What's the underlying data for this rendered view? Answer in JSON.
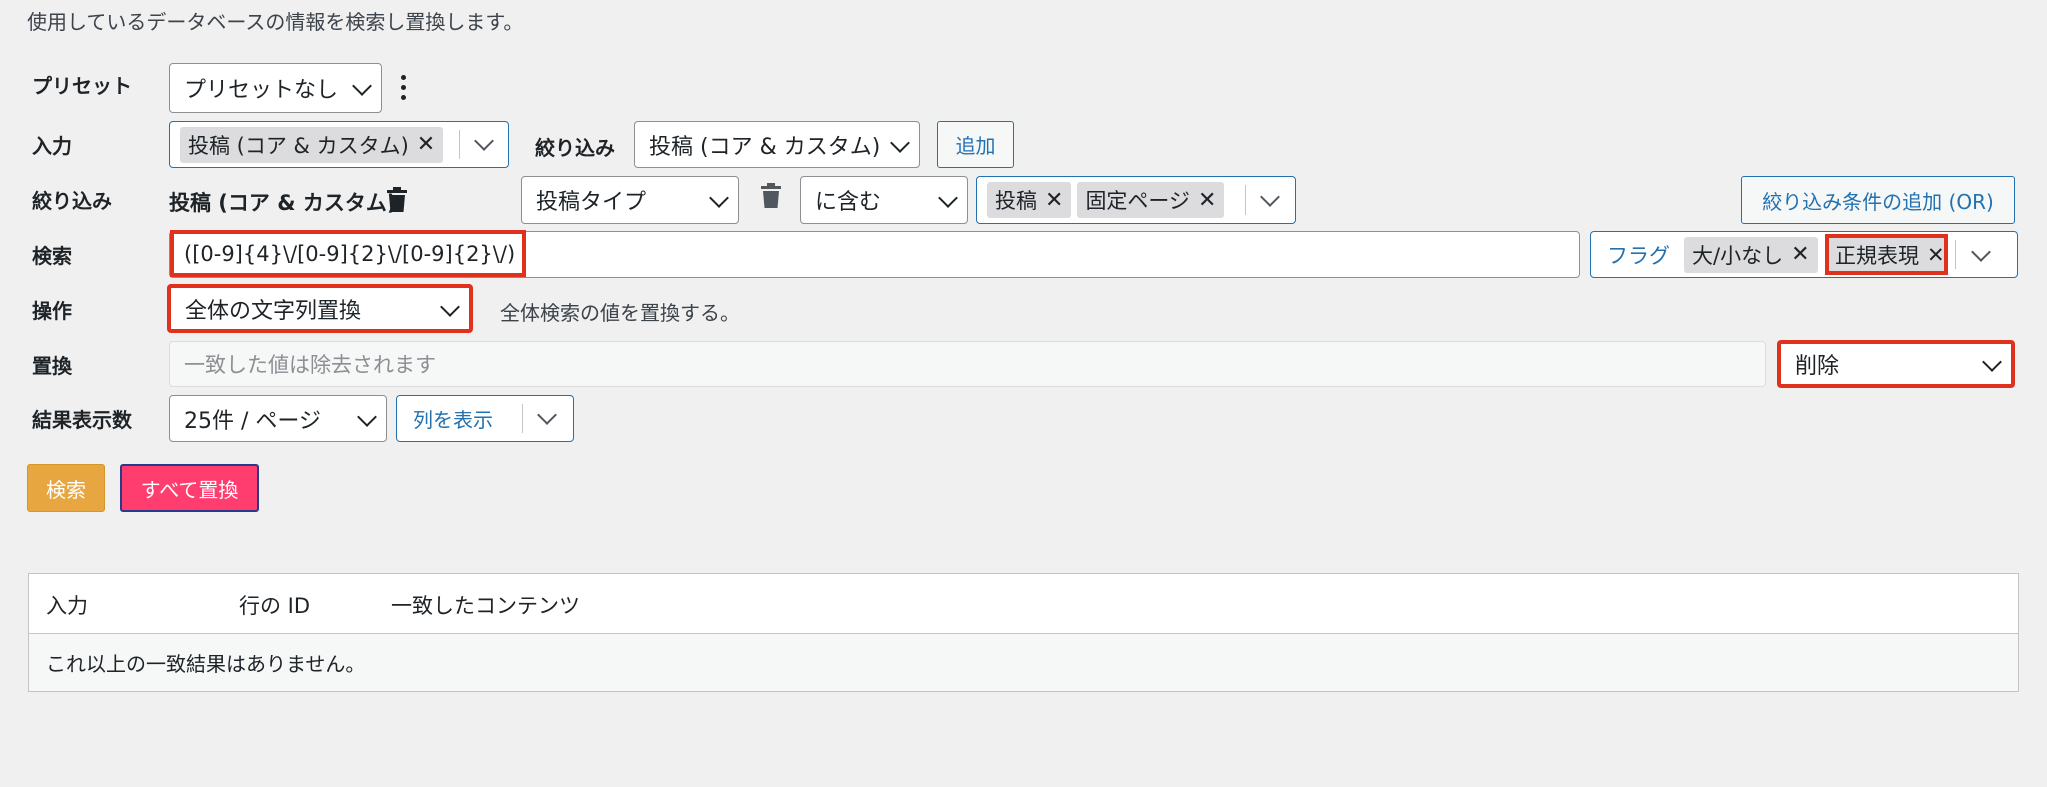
{
  "description": "使用しているデータベースの情報を検索し置換します。",
  "preset": {
    "label": "プリセット",
    "value": "プリセットなし"
  },
  "input_row": {
    "label": "入力",
    "chip": "投稿 (コア & カスタム)",
    "filter_label": "絞り込み",
    "filter_select": "投稿 (コア & カスタム)",
    "add_button": "追加"
  },
  "filter_row": {
    "label": "絞り込み",
    "group_title": "投稿 (コア & カスタム)",
    "field_select": "投稿タイプ",
    "operator_select": "に含む",
    "chips": [
      "投稿",
      "固定ページ"
    ],
    "add_or_button": "絞り込み条件の追加 (OR)"
  },
  "search_row": {
    "label": "検索",
    "value": "([0-9]{4}\\/[0-9]{2}\\/[0-9]{2}\\/)",
    "flags_label": "フラグ",
    "flag_chips": [
      "大/小なし",
      "正規表現"
    ]
  },
  "action_row": {
    "label": "操作",
    "select": "全体の文字列置換",
    "hint": "全体検索の値を置換する。"
  },
  "replace_row": {
    "label": "置換",
    "placeholder": "一致した値は除去されます",
    "select": "削除"
  },
  "results_row": {
    "label": "結果表示数",
    "per_page": "25件 / ページ",
    "columns_button": "列を表示"
  },
  "buttons": {
    "search": "検索",
    "replace_all": "すべて置換"
  },
  "table": {
    "columns": [
      "入力",
      "行の ID",
      "一致したコンテンツ"
    ],
    "empty_message": "これ以上の一致結果はありません。"
  },
  "colors": {
    "accent": "#2271b1",
    "highlight": "#e0301e",
    "search_button": "#e7a63f",
    "replace_button": "#ff3d6e"
  }
}
